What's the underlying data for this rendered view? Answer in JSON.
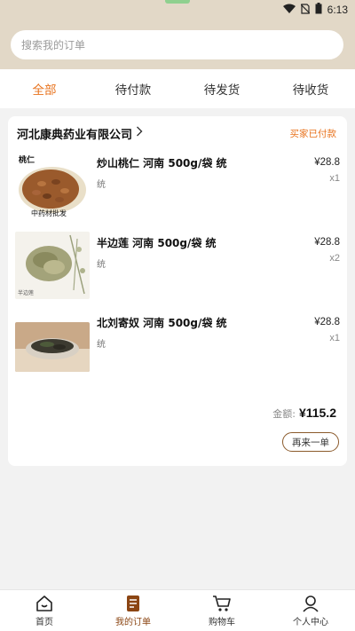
{
  "status_bar": {
    "time": "6:13"
  },
  "search": {
    "placeholder": "搜索我的订单"
  },
  "tabs": [
    {
      "label": "全部",
      "active": true
    },
    {
      "label": "待付款"
    },
    {
      "label": "待发货"
    },
    {
      "label": "待收货"
    }
  ],
  "order": {
    "shop_name": "河北康典药业有限公司",
    "status": "买家已付款",
    "items": [
      {
        "name": "炒山桃仁 河南 500g/袋 统",
        "spec": "统",
        "price": "¥28.8",
        "qty": "x1",
        "thumb_label": "桃仁",
        "thumb_caption": "中药材批发"
      },
      {
        "name": "半边莲 河南 500g/袋 统",
        "spec": "统",
        "price": "¥28.8",
        "qty": "x2",
        "thumb_label": "半边莲"
      },
      {
        "name": "北刘寄奴 河南 500g/袋 统",
        "spec": "统",
        "price": "¥28.8",
        "qty": "x1"
      }
    ],
    "total_label": "金额:",
    "total_value": "¥115.2",
    "reorder_label": "再来一单"
  },
  "bottom_nav": [
    {
      "label": "首页",
      "icon": "home-icon"
    },
    {
      "label": "我的订单",
      "icon": "orders-icon",
      "active": true
    },
    {
      "label": "购物车",
      "icon": "cart-icon"
    },
    {
      "label": "个人中心",
      "icon": "user-icon"
    }
  ],
  "colors": {
    "accent": "#e8721c",
    "header_bg": "#e2d8c7",
    "nav_active": "#8b4513"
  }
}
